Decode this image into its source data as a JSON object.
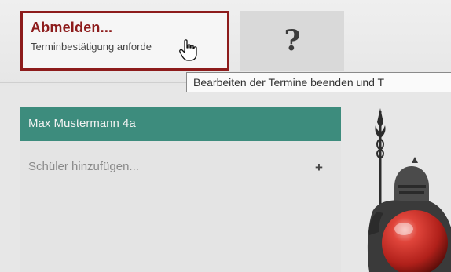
{
  "header": {
    "logout": {
      "title": "Abmelden...",
      "subtitle": "Terminbestätigung anforde"
    },
    "help": {
      "label": "?"
    },
    "tooltip": "Bearbeiten der Termine beenden und T"
  },
  "sidebar": {
    "students": [
      {
        "label": "Max Mustermann 4a"
      }
    ],
    "add_student": {
      "placeholder": "Schüler hinzufügen...",
      "button_label": "+"
    }
  },
  "decoration": {
    "mascot_icon": "knight-with-red-ball-icon",
    "cursor_icon": "hand-pointer-icon"
  },
  "colors": {
    "accent_red": "#8d1c1c",
    "selected_teal": "#3d8c7d",
    "ball_red": "#c62a22"
  }
}
